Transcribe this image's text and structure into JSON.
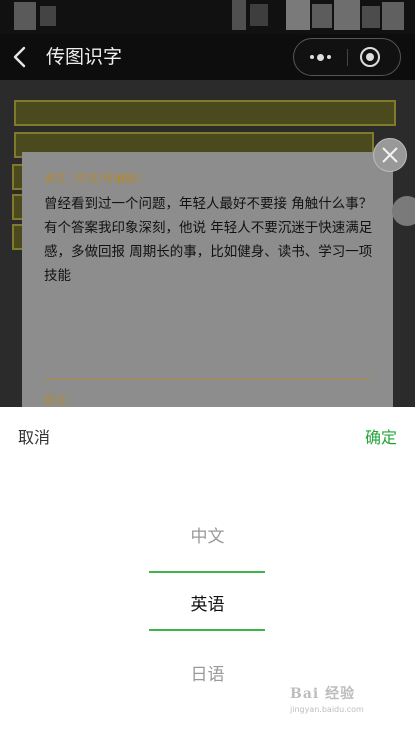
{
  "nav": {
    "title": "传图识字"
  },
  "card": {
    "translation_label": "译文（中文/可编辑）：",
    "translation_text": "曾经看到过一个问题，年轻人最好不要接 角触什么事？有个答案我印象深刻，他说 年轻人不要沉迷于快速满足感，多做回报 周期长的事，比如健身、读书、学习一项 技能",
    "original_label": "原文："
  },
  "picker": {
    "cancel_label": "取消",
    "confirm_label": "确定",
    "options": [
      "中文",
      "英语",
      "日语"
    ],
    "selected": "英语"
  },
  "watermark": {
    "text": "Bai 经验",
    "sub": "jingyan.baidu.com"
  },
  "colors": {
    "accent_green": "#21a53a",
    "selector_green": "#3cb64a",
    "label_gold": "#b38a2f"
  }
}
